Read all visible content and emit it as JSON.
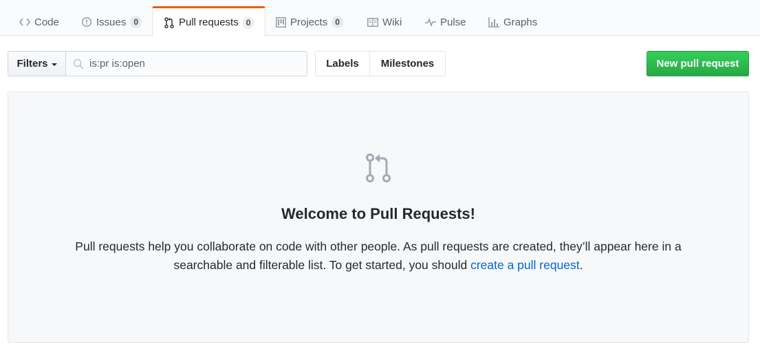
{
  "tabs": {
    "code": {
      "label": "Code",
      "icon": "code-icon"
    },
    "issues": {
      "label": "Issues",
      "count": "0",
      "icon": "issue-opened-icon"
    },
    "pull_requests": {
      "label": "Pull requests",
      "count": "0",
      "icon": "git-pull-request-icon",
      "selected": true
    },
    "projects": {
      "label": "Projects",
      "count": "0",
      "icon": "project-icon"
    },
    "wiki": {
      "label": "Wiki",
      "icon": "book-icon"
    },
    "pulse": {
      "label": "Pulse",
      "icon": "pulse-icon"
    },
    "graphs": {
      "label": "Graphs",
      "icon": "graph-icon"
    }
  },
  "toolbar": {
    "filters_label": "Filters",
    "search_value": "is:pr is:open",
    "search_icon": "search-icon",
    "labels_label": "Labels",
    "milestones_label": "Milestones",
    "new_pr_label": "New pull request"
  },
  "blankslate": {
    "icon": "git-pull-request-icon",
    "title": "Welcome to Pull Requests!",
    "text_before_link": "Pull requests help you collaborate on code with other people. As pull requests are created, they’ll appear here in a searchable and filterable list. To get started, you should ",
    "link_text": "create a pull request",
    "text_after_link": "."
  },
  "colors": {
    "accent_tab_border": "#e36209",
    "primary_button": "#28a745",
    "link": "#0366d6",
    "blankslate_bg": "#f6f8fa"
  }
}
